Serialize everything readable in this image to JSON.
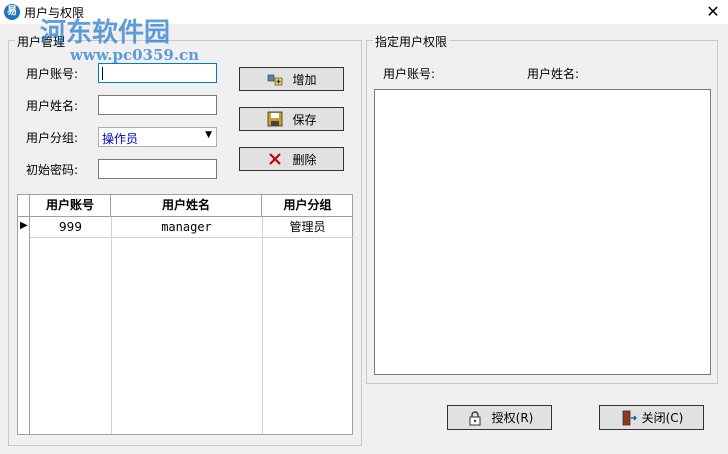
{
  "window": {
    "title": "用户与权限",
    "close_glyph": "✕",
    "app_icon_glyph": "易"
  },
  "watermark": {
    "name": "河东软件园",
    "url": "www.pc0359.cn"
  },
  "user_mgmt": {
    "group_title": "用户管理",
    "account_label": "用户账号:",
    "name_label": "用户姓名:",
    "group_label": "用户分组:",
    "password_label": "初始密码:",
    "account_value": "",
    "name_value": "",
    "group_value": "操作员",
    "password_value": ""
  },
  "buttons": {
    "add": "增加",
    "save": "保存",
    "delete": "删除",
    "authorize": "授权(R)",
    "close": "关闭(C)"
  },
  "grid": {
    "columns": [
      "用户账号",
      "用户姓名",
      "用户分组"
    ],
    "rows": [
      {
        "account": "999",
        "name": "manager",
        "group": "管理员",
        "pointer": "▶"
      }
    ]
  },
  "permissions": {
    "group_title": "指定用户权限",
    "account_label": "用户账号:",
    "name_label": "用户姓名:"
  },
  "icons": {
    "add": "add-user-icon",
    "save": "floppy-disk-icon",
    "delete": "red-x-icon",
    "authorize": "lock-icon",
    "close": "exit-door-icon",
    "dropdown": "chevron-down-icon"
  },
  "colors": {
    "accent": "#0078d7",
    "delete_red": "#cc0000",
    "group_value_blue": "#0000c0"
  }
}
